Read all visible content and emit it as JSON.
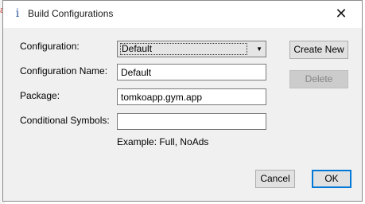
{
  "background": {
    "edge_mark": "a"
  },
  "dialog": {
    "title": "Build Configurations",
    "title_icon": "info-icon",
    "close_glyph": "✕"
  },
  "form": {
    "configuration_label": "Configuration:",
    "configuration_value": "Default",
    "configuration_name_label": "Configuration Name:",
    "configuration_name_value": "Default",
    "package_label": "Package:",
    "package_value": "tomkoapp.gym.app",
    "symbols_label": "Conditional Symbols:",
    "symbols_value": "",
    "symbols_hint": "Example: Full, NoAds"
  },
  "buttons": {
    "create_new": "Create New",
    "delete": "Delete",
    "cancel": "Cancel",
    "ok": "OK"
  },
  "colors": {
    "accent": "#0078d7",
    "dialog_bg": "#f0f0f0",
    "title_bar": "#ffffff",
    "edge_mark": "#c8342b"
  }
}
